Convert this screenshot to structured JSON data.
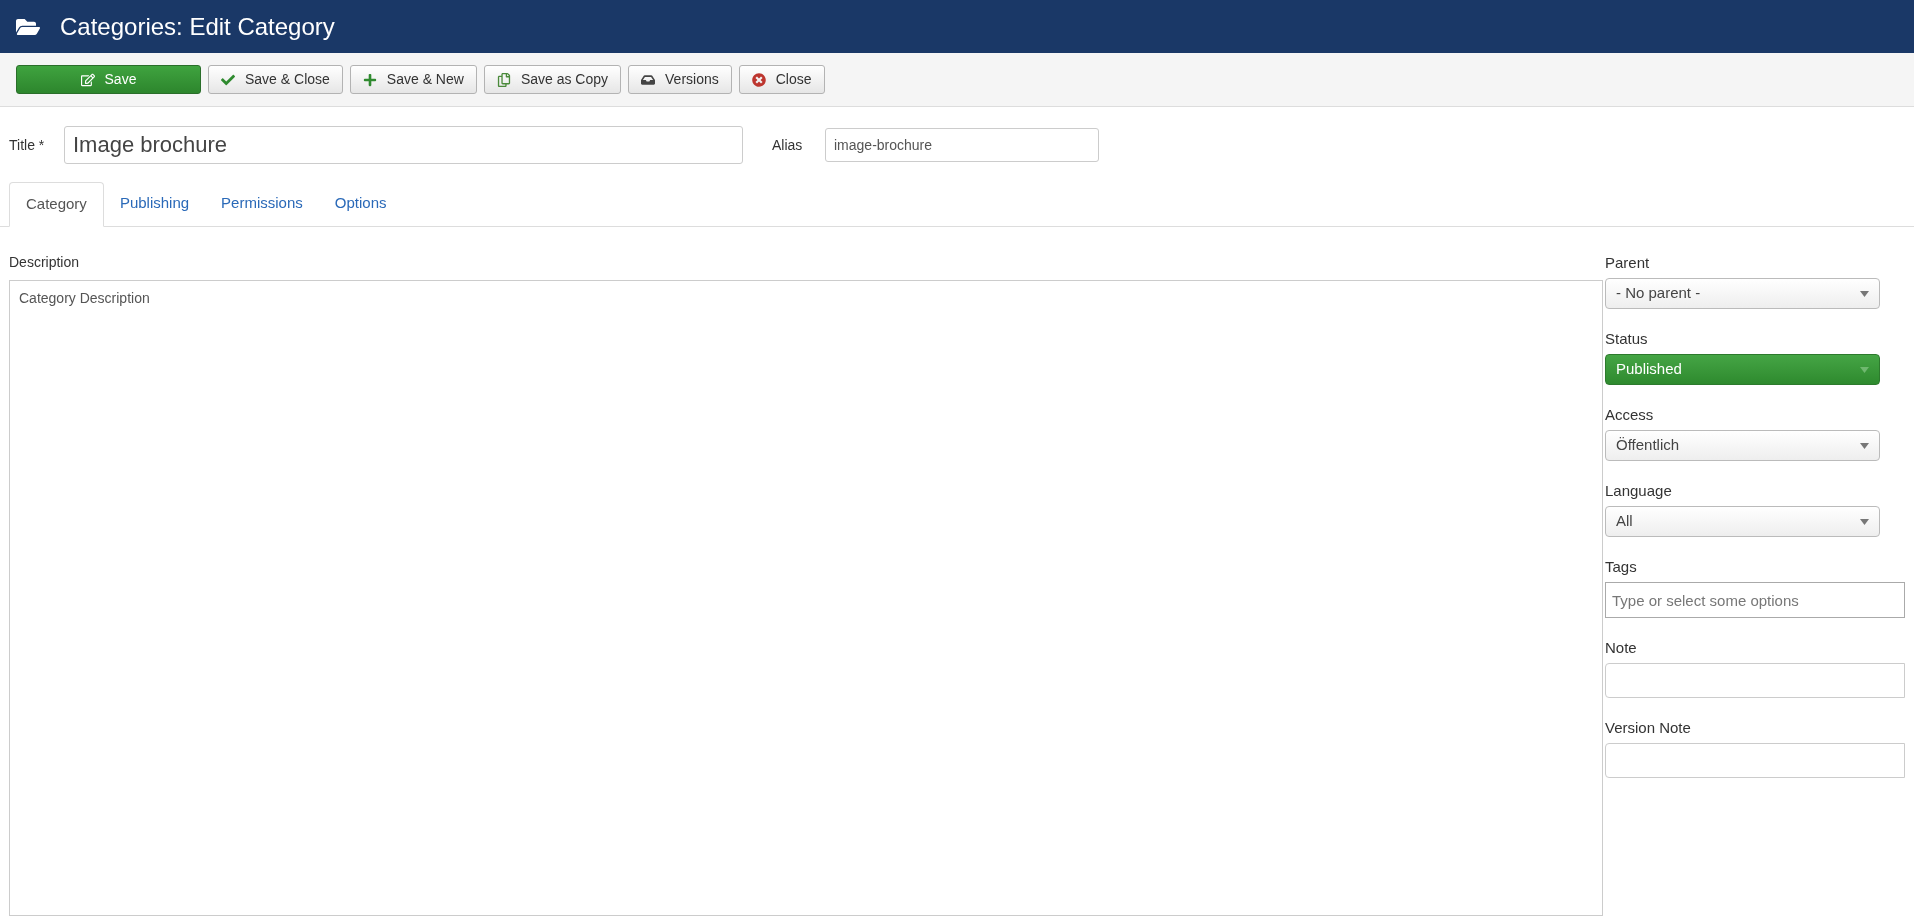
{
  "header": {
    "title": "Categories: Edit Category"
  },
  "toolbar": [
    {
      "label": "Save",
      "kind": "save"
    },
    {
      "label": "Save & Close",
      "kind": "check"
    },
    {
      "label": "Save & New",
      "kind": "new"
    },
    {
      "label": "Save as Copy",
      "kind": "copy"
    },
    {
      "label": "Versions",
      "kind": "versions"
    },
    {
      "label": "Close",
      "kind": "close"
    }
  ],
  "title_field": {
    "label": "Title *",
    "value": "Image brochure"
  },
  "alias_field": {
    "label": "Alias",
    "value": "image-brochure"
  },
  "tabs": [
    {
      "label": "Category",
      "selected": true
    },
    {
      "label": "Publishing",
      "selected": false
    },
    {
      "label": "Permissions",
      "selected": false
    },
    {
      "label": "Options",
      "selected": false
    }
  ],
  "description": {
    "label": "Description",
    "value": "Category Description"
  },
  "side_fields": [
    {
      "label": "Parent",
      "kind": "select",
      "value": "- No parent -",
      "highlighted": false
    },
    {
      "label": "Status",
      "kind": "select",
      "value": "Published",
      "highlighted": true
    },
    {
      "label": "Access",
      "kind": "select",
      "value": "Öffentlich",
      "highlighted": false
    },
    {
      "label": "Language",
      "kind": "select",
      "value": "All",
      "highlighted": false
    },
    {
      "label": "Tags",
      "kind": "tags",
      "placeholder": "Type or select some options"
    },
    {
      "label": "Note",
      "kind": "text"
    },
    {
      "label": "Version Note",
      "kind": "text"
    }
  ]
}
